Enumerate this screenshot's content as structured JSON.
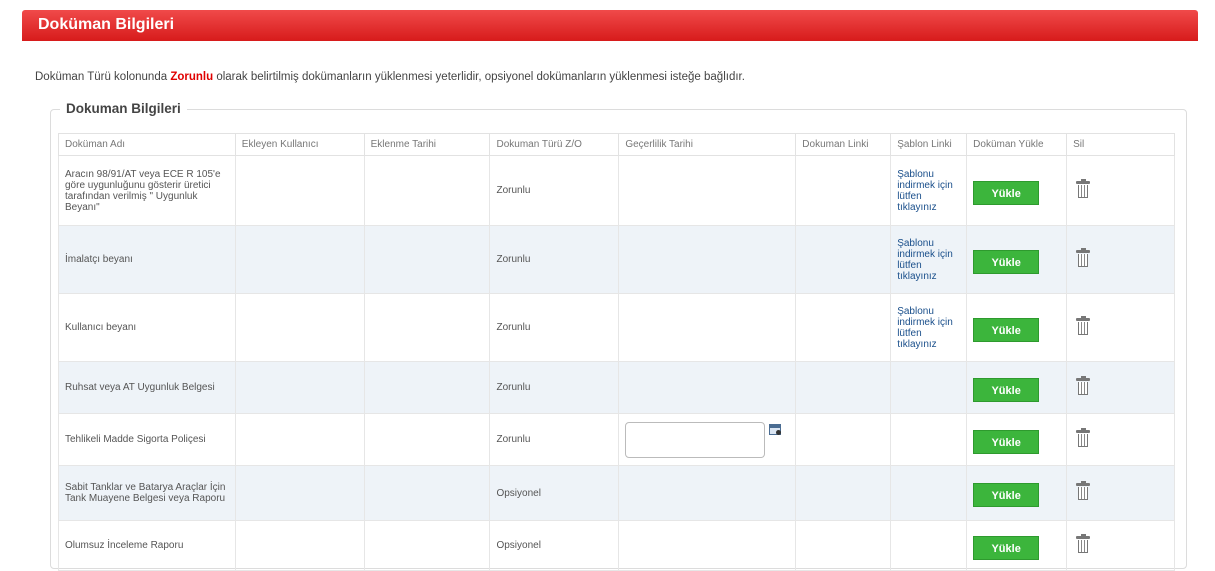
{
  "header": {
    "title": "Doküman Bilgileri"
  },
  "info": {
    "before": "Doküman Türü kolonunda ",
    "highlight": "Zorunlu",
    "after": " olarak belirtilmiş dokümanların yüklenmesi yeterlidir, opsiyonel dokümanların yüklenmesi isteğe bağlıdır."
  },
  "section": {
    "title": "Dokuman Bilgileri"
  },
  "table": {
    "columns": [
      "Doküman Adı",
      "Ekleyen Kullanıcı",
      "Eklenme Tarihi",
      "Dokuman Türü Z/O",
      "Geçerlilik Tarihi",
      "Dokuman Linki",
      "Şablon Linki",
      "Doküman Yükle",
      "Sil"
    ],
    "rows": [
      {
        "name": "Aracın 98/91/AT veya ECE R 105'e göre uygunluğunu gösterir üretici tarafından verilmiş \" Uygunluk Beyanı\"",
        "type": "Zorunlu",
        "template": "Şablonu indirmek için lütfen tıklayınız",
        "upload": "Yükle"
      },
      {
        "name": "İmalatçı beyanı",
        "type": "Zorunlu",
        "template": "Şablonu indirmek için lütfen tıklayınız",
        "upload": "Yükle"
      },
      {
        "name": "Kullanıcı beyanı",
        "type": "Zorunlu",
        "template": "Şablonu indirmek için lütfen tıklayınız",
        "upload": "Yükle"
      },
      {
        "name": "Ruhsat veya AT Uygunluk Belgesi",
        "type": "Zorunlu",
        "template": "",
        "upload": "Yükle"
      },
      {
        "name": "Tehlikeli Madde Sigorta Poliçesi",
        "type": "Zorunlu",
        "template": "",
        "upload": "Yükle",
        "date_value": ""
      },
      {
        "name": "Sabit Tanklar ve Batarya Araçlar İçin Tank Muayene Belgesi veya Raporu",
        "type": "Opsiyonel",
        "template": "",
        "upload": "Yükle"
      },
      {
        "name": "Olumsuz İnceleme Raporu",
        "type": "Opsiyonel",
        "template": "",
        "upload": "Yükle"
      }
    ]
  },
  "colors": {
    "header_red": "#e32b2b",
    "highlight_red": "#e00000",
    "upload_green": "#3cb53c",
    "link_blue": "#1a4f8b",
    "row_alt": "#eef3f8"
  },
  "icons": {
    "delete": "trash-icon",
    "date_picker": "calendar-icon"
  }
}
